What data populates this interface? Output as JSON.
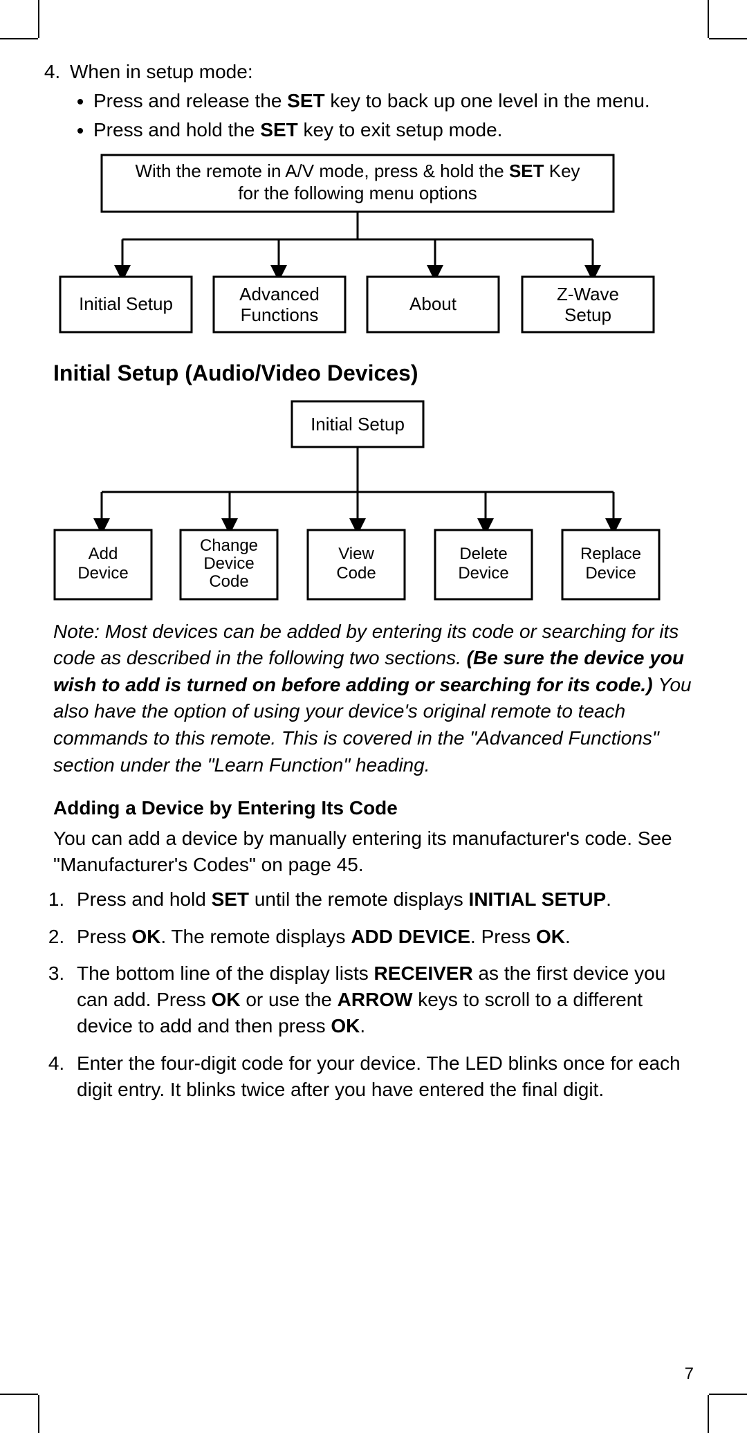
{
  "step4": {
    "intro": "When in setup mode:",
    "b1_pre": "Press and release the ",
    "b1_key": "SET",
    "b1_post": " key to back up one level in the menu.",
    "b2_pre": "Press and hold the ",
    "b2_key": "SET",
    "b2_post": " key to exit setup mode."
  },
  "diagram1": {
    "rootline1_pre": "With the remote in A/V mode, press & hold the ",
    "rootline1_key": "SET",
    "rootline1_post": " Key",
    "rootline2": "for the following menu options",
    "c1": "Initial Setup",
    "c2a": "Advanced",
    "c2b": "Functions",
    "c3": "About",
    "c4a": "Z-Wave",
    "c4b": "Setup"
  },
  "section_heading": "Initial Setup (Audio/Video Devices)",
  "diagram2": {
    "root": "Initial Setup",
    "c1a": "Add",
    "c1b": "Device",
    "c2a": "Change",
    "c2b": "Device",
    "c2c": "Code",
    "c3a": "View",
    "c3b": "Code",
    "c4a": "Delete",
    "c4b": "Device",
    "c5a": "Replace",
    "c5b": "Device"
  },
  "note": {
    "n1": "Note: Most devices can be added by entering its code or searching for its code as described in the following two sections. ",
    "bold": "(Be sure the device you wish to add is turned on before adding or searching for its code.) ",
    "n2": "You also have the option of using your device's original remote to teach commands to this remote. This is covered in the \"Advanced Functions\" section under the \"Learn Function\" heading."
  },
  "add": {
    "heading": "Adding a Device by Entering Its Code",
    "intro": "You can add a device by manually entering its manufacturer's code. See \"Manufacturer's Codes\" on page 45.",
    "s1_pre": "Press and hold ",
    "s1_k1": "SET",
    "s1_mid": " until the remote displays ",
    "s1_k2": "INITIAL SETUP",
    "s1_post": ".",
    "s2_pre": "Press ",
    "s2_k1": "OK",
    "s2_mid": ". The remote displays ",
    "s2_k2": "ADD DEVICE",
    "s2_mid2": ". Press ",
    "s2_k3": "OK",
    "s2_post": ".",
    "s3_pre": "The bottom line of the display lists ",
    "s3_k1": "RECEIVER",
    "s3_mid1": " as the first device you can add. Press ",
    "s3_k2": "OK",
    "s3_mid2": " or use the ",
    "s3_k3": "ARROW",
    "s3_mid3": " keys to scroll to a different device to add and then press ",
    "s3_k4": "OK",
    "s3_post": ".",
    "s4": "Enter the four-digit code for your device. The LED blinks once for each digit entry. It blinks twice after you have entered the final digit."
  },
  "pagenum": "7"
}
